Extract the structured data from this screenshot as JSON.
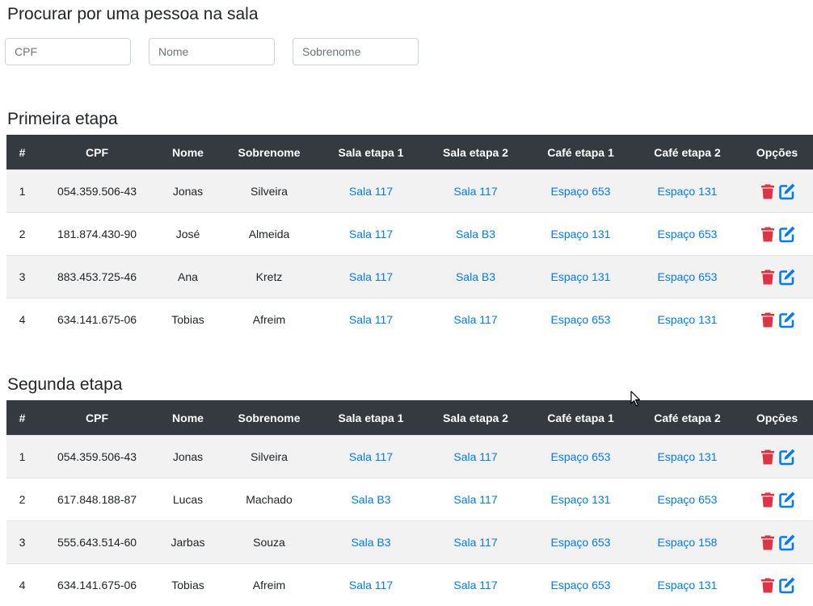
{
  "search": {
    "title": "Procurar por uma pessoa na sala",
    "cpf_placeholder": "CPF",
    "nome_placeholder": "Nome",
    "sobrenome_placeholder": "Sobrenome"
  },
  "headers": [
    "#",
    "CPF",
    "Nome",
    "Sobrenome",
    "Sala etapa 1",
    "Sala etapa 2",
    "Café etapa 1",
    "Café etapa 2",
    "Opções"
  ],
  "tables": [
    {
      "title": "Primeira etapa",
      "rows": [
        {
          "n": "1",
          "cpf": "054.359.506-43",
          "nome": "Jonas",
          "sobrenome": "Silveira",
          "sala1": "Sala 117",
          "sala2": "Sala 117",
          "cafe1": "Espaço 653",
          "cafe2": "Espaço 131"
        },
        {
          "n": "2",
          "cpf": "181.874.430-90",
          "nome": "José",
          "sobrenome": "Almeida",
          "sala1": "Sala 117",
          "sala2": "Sala B3",
          "cafe1": "Espaço 131",
          "cafe2": "Espaço 653"
        },
        {
          "n": "3",
          "cpf": "883.453.725-46",
          "nome": "Ana",
          "sobrenome": "Kretz",
          "sala1": "Sala 117",
          "sala2": "Sala B3",
          "cafe1": "Espaço 131",
          "cafe2": "Espaço 653"
        },
        {
          "n": "4",
          "cpf": "634.141.675-06",
          "nome": "Tobias",
          "sobrenome": "Afreim",
          "sala1": "Sala 117",
          "sala2": "Sala 117",
          "cafe1": "Espaço 653",
          "cafe2": "Espaço 131"
        }
      ]
    },
    {
      "title": "Segunda etapa",
      "rows": [
        {
          "n": "1",
          "cpf": "054.359.506-43",
          "nome": "Jonas",
          "sobrenome": "Silveira",
          "sala1": "Sala 117",
          "sala2": "Sala 117",
          "cafe1": "Espaço 653",
          "cafe2": "Espaço 131"
        },
        {
          "n": "2",
          "cpf": "617.848.188-87",
          "nome": "Lucas",
          "sobrenome": "Machado",
          "sala1": "Sala B3",
          "sala2": "Sala 117",
          "cafe1": "Espaço 131",
          "cafe2": "Espaço 653"
        },
        {
          "n": "3",
          "cpf": "555.643.514-60",
          "nome": "Jarbas",
          "sobrenome": "Souza",
          "sala1": "Sala B3",
          "sala2": "Sala 117",
          "cafe1": "Espaço 653",
          "cafe2": "Espaço 158"
        },
        {
          "n": "4",
          "cpf": "634.141.675-06",
          "nome": "Tobias",
          "sobrenome": "Afreim",
          "sala1": "Sala 117",
          "sala2": "Sala 117",
          "cafe1": "Espaço 653",
          "cafe2": "Espaço 131"
        }
      ]
    }
  ],
  "icons": {
    "delete": "trash-icon",
    "edit": "edit-icon"
  },
  "colors": {
    "header_bg": "#343a40",
    "link": "#007bff",
    "delete": "#dc3545",
    "edit": "#007bff",
    "stripe": "#f2f2f2"
  }
}
